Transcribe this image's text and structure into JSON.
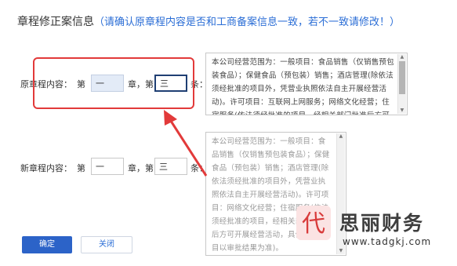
{
  "header": {
    "title": "章程修正案信息",
    "note": "（请确认原章程内容是否和工商备案信息一致，若不一致请修改！）"
  },
  "original": {
    "label": "原章程内容：",
    "prefix": "第",
    "chapter_value": "一",
    "chapter_suffix": "章，第",
    "article_value": "三",
    "article_suffix": "条：",
    "text": "本公司经营范围为：一般项目：食品销售（仅销售预包装食品）；保健食品（预包装）销售；酒店管理(除依法须经批准的项目外，凭营业执照依法自主开展经营活动)。许可项目：互联网上网服务；网络文化经营；住宿服务(依法须经批准的项目，经相关部门批准后方可开展经营活动，具"
  },
  "revised": {
    "label": "新章程内容：",
    "prefix": "第",
    "chapter_value": "一",
    "chapter_suffix": "章，第",
    "article_value": "三",
    "article_suffix": "条：",
    "text": "本公司经营范围为：一般项目：食品销售（仅销售预包装食品）；保健食品（预包装）销售；酒店管理(除依法须经批准的项目外，凭营业执照依法自主开展经营活动)。许可项目：网络文化经营；住宿服务(依法须经批准的项目，经相关部门批准后方可开展经营活动，具体经营项目以审批结果为准)。"
  },
  "buttons": {
    "confirm": "确定",
    "close": "关闭"
  },
  "watermark": {
    "brand": "思丽财务",
    "url": "www.tadgkj.com",
    "logo_char": "代"
  },
  "colors": {
    "accent": "#2b6ed6",
    "primary_button": "#2c63c8",
    "annotation": "#e23a3a"
  },
  "icons": {
    "arrow": "red-annotation-arrow",
    "scroll_up": "scroll-up-arrow",
    "scroll_down": "scroll-down-arrow"
  }
}
